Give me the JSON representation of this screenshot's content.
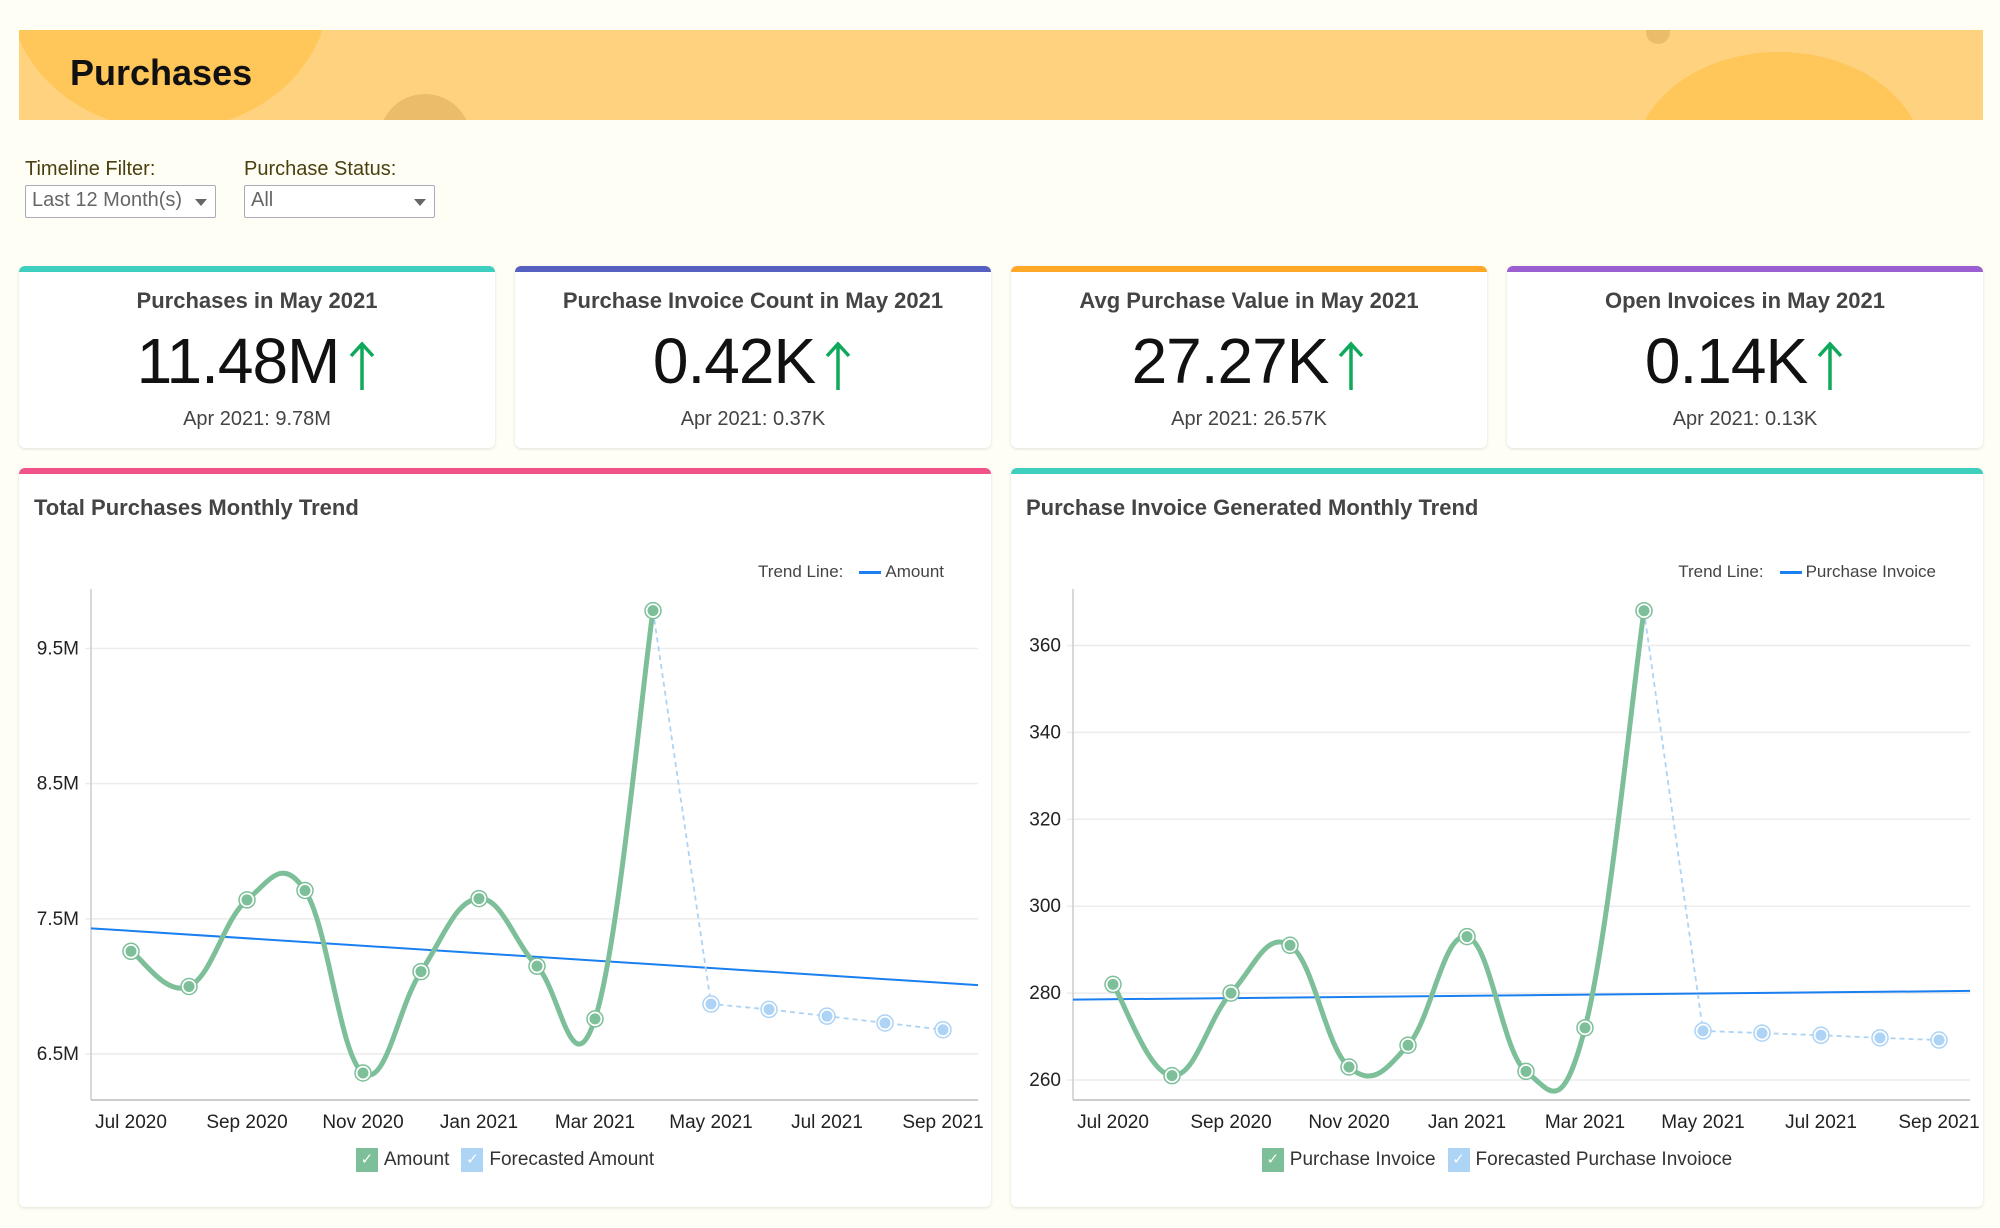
{
  "header": {
    "title": "Purchases"
  },
  "filters": [
    {
      "label": "Timeline Filter:",
      "value": "Last 12 Month(s)"
    },
    {
      "label": "Purchase Status:",
      "value": "All"
    }
  ],
  "kpis": [
    {
      "title": "Purchases in May 2021",
      "value": "11.48M",
      "trend": "up",
      "previous": "Apr 2021: 9.78M",
      "accent": "#3ecfbf"
    },
    {
      "title": "Purchase Invoice Count in May 2021",
      "value": "0.42K",
      "trend": "up",
      "previous": "Apr 2021: 0.37K",
      "accent": "#5560c0"
    },
    {
      "title": "Avg Purchase Value in May 2021",
      "value": "27.27K",
      "trend": "up",
      "previous": "Apr 2021: 26.57K",
      "accent": "#ffa726"
    },
    {
      "title": "Open Invoices in May 2021",
      "value": "0.14K",
      "trend": "up",
      "previous": "Apr 2021: 0.13K",
      "accent": "#9b5fd1"
    }
  ],
  "colors": {
    "up_arrow": "#10a85a",
    "actual_series": "#7dbf99",
    "forecast_series": "#add3f5",
    "trend_line": "#1a7ff0"
  },
  "chart_data": [
    {
      "type": "line",
      "title": "Total Purchases Monthly Trend",
      "accent": "#f0528a",
      "trend_legend_label": "Trend Line:",
      "trend_legend_series": "Amount",
      "x": [
        "Jul 2020",
        "Aug 2020",
        "Sep 2020",
        "Oct 2020",
        "Nov 2020",
        "Dec 2020",
        "Jan 2021",
        "Feb 2021",
        "Mar 2021",
        "Apr 2021",
        "May 2021",
        "Jun 2021",
        "Jul 2021",
        "Aug 2021",
        "Sep 2021"
      ],
      "x_tick_labels": [
        "Jul 2020",
        "Sep 2020",
        "Nov 2020",
        "Jan 2021",
        "Mar 2021",
        "May 2021",
        "Jul 2021",
        "Sep 2021"
      ],
      "y_tick_values": [
        6.5,
        7.5,
        8.5,
        9.5
      ],
      "y_tick_labels": [
        "6.5M",
        "7.5M",
        "8.5M",
        "9.5M"
      ],
      "y_unit": "M",
      "ylim": [
        6.16,
        9.94
      ],
      "series": [
        {
          "name": "Amount",
          "values": [
            7.26,
            7.0,
            7.64,
            7.71,
            6.36,
            7.11,
            7.65,
            7.15,
            6.76,
            9.78,
            null,
            null,
            null,
            null,
            null
          ]
        },
        {
          "name": "Forecasted Amount",
          "values": [
            null,
            null,
            null,
            null,
            null,
            null,
            null,
            null,
            null,
            9.78,
            6.87,
            6.83,
            6.78,
            6.73,
            6.68
          ]
        }
      ],
      "trend_line": {
        "name": "Amount",
        "start": 7.43,
        "end": 7.01
      },
      "legend": [
        "Amount",
        "Forecasted Amount"
      ],
      "grid": true
    },
    {
      "type": "line",
      "title": "Purchase Invoice Generated Monthly Trend",
      "accent": "#3ecfbf",
      "trend_legend_label": "Trend Line:",
      "trend_legend_series": "Purchase Invoice",
      "x": [
        "Jul 2020",
        "Aug 2020",
        "Sep 2020",
        "Oct 2020",
        "Nov 2020",
        "Dec 2020",
        "Jan 2021",
        "Feb 2021",
        "Mar 2021",
        "Apr 2021",
        "May 2021",
        "Jun 2021",
        "Jul 2021",
        "Aug 2021",
        "Sep 2021"
      ],
      "x_tick_labels": [
        "Jul 2020",
        "Sep 2020",
        "Nov 2020",
        "Jan 2021",
        "Mar 2021",
        "May 2021",
        "Jul 2021",
        "Sep 2021"
      ],
      "y_tick_values": [
        260,
        280,
        300,
        320,
        340,
        360
      ],
      "y_tick_labels": [
        "260",
        "280",
        "300",
        "320",
        "340",
        "360"
      ],
      "y_unit": "",
      "ylim": [
        255.4,
        373
      ],
      "series": [
        {
          "name": "Purchase Invoice",
          "values": [
            282,
            261,
            280,
            291,
            263,
            268,
            293,
            262,
            272,
            368,
            null,
            null,
            null,
            null,
            null
          ]
        },
        {
          "name": "Forecasted Purchase Invoioce",
          "values": [
            null,
            null,
            null,
            null,
            null,
            null,
            null,
            null,
            null,
            368,
            271.3,
            270.8,
            270.3,
            269.7,
            269.2
          ]
        }
      ],
      "trend_line": {
        "name": "Purchase Invoice",
        "start": 278.5,
        "end": 280.5
      },
      "legend": [
        "Purchase Invoice",
        "Forecasted Purchase Invoioce"
      ],
      "grid": true
    }
  ]
}
